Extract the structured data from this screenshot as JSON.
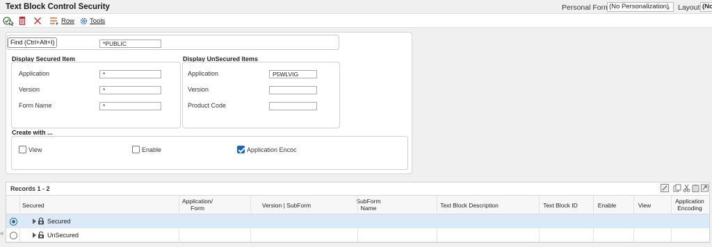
{
  "window": {
    "title": "Text Block Control Security",
    "personal_form_label": "Personal Form:",
    "personal_form_value": "(No Personalization)",
    "layout_label": "Layout:",
    "layout_value": "(No"
  },
  "toolbar": {
    "items": [
      {
        "icon": "ok-checkmark-icon"
      },
      {
        "icon": "delete-icon"
      },
      {
        "icon": "cancel-x-icon"
      },
      {
        "icon": "row-exit-icon",
        "label": "Row"
      },
      {
        "icon": "tools-gear-icon",
        "label": "Tools"
      }
    ]
  },
  "find": {
    "button_label": "Find (Ctrl+Alt+I)",
    "value": "*PUBLIC"
  },
  "secured": {
    "title": "Display Secured Item",
    "fields": [
      {
        "label": "Application",
        "value": "*"
      },
      {
        "label": "Version",
        "value": "*"
      },
      {
        "label": "Form Name",
        "value": "*"
      }
    ]
  },
  "unsecured": {
    "title": "Display UnSecured Items",
    "fields": [
      {
        "label": "Application",
        "value": "P5WLVIG"
      },
      {
        "label": "Version",
        "value": ""
      },
      {
        "label": "Product Code",
        "value": ""
      }
    ]
  },
  "create_with": {
    "title": "Create with ...",
    "options": [
      {
        "label": "View",
        "checked": false
      },
      {
        "label": "Enable",
        "checked": false
      },
      {
        "label": "Application Encoc",
        "checked": true
      }
    ]
  },
  "grid": {
    "records_label": "Records 1 - 2",
    "columns": [
      "Secured",
      "Application/ Form",
      "Version | SubForm",
      "SubForm Name",
      "Text Block Description",
      "Text Block ID",
      "Enable",
      "View",
      "Application Encoding"
    ],
    "rows": [
      {
        "label": "Secured",
        "selected": true
      },
      {
        "label": "UnSecured",
        "selected": false
      }
    ],
    "collapse_glyph": "«"
  },
  "colors": {
    "accent": "#1565c0",
    "selected_row": "#dbeaf8",
    "delete_red": "#c62828"
  }
}
